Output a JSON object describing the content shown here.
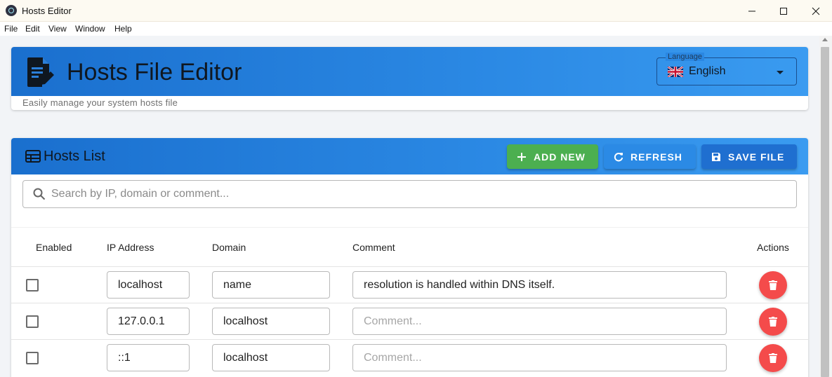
{
  "window": {
    "title": "Hosts Editor"
  },
  "menu": {
    "items": [
      "File",
      "Edit",
      "View",
      "Window",
      "Help"
    ]
  },
  "header": {
    "title": "Hosts File Editor",
    "subtitle": "Easily manage your system hosts file",
    "language": {
      "label": "Language",
      "value": "English"
    }
  },
  "hosts_list": {
    "title": "Hosts List",
    "buttons": {
      "add": "ADD NEW",
      "refresh": "REFRESH",
      "save": "SAVE FILE"
    },
    "search_placeholder": "Search by IP, domain or comment...",
    "columns": {
      "enabled": "Enabled",
      "ip": "IP Address",
      "domain": "Domain",
      "comment": "Comment",
      "actions": "Actions"
    },
    "comment_placeholder": "Comment...",
    "rows": [
      {
        "enabled": false,
        "ip": "localhost",
        "domain": "name",
        "comment": "resolution is handled within DNS itself."
      },
      {
        "enabled": false,
        "ip": "127.0.0.1",
        "domain": "localhost",
        "comment": ""
      },
      {
        "enabled": false,
        "ip": "::1",
        "domain": "localhost",
        "comment": ""
      }
    ]
  },
  "colors": {
    "accent": "#2b89e4",
    "add": "#4caf50",
    "delete": "#f44b4b"
  }
}
